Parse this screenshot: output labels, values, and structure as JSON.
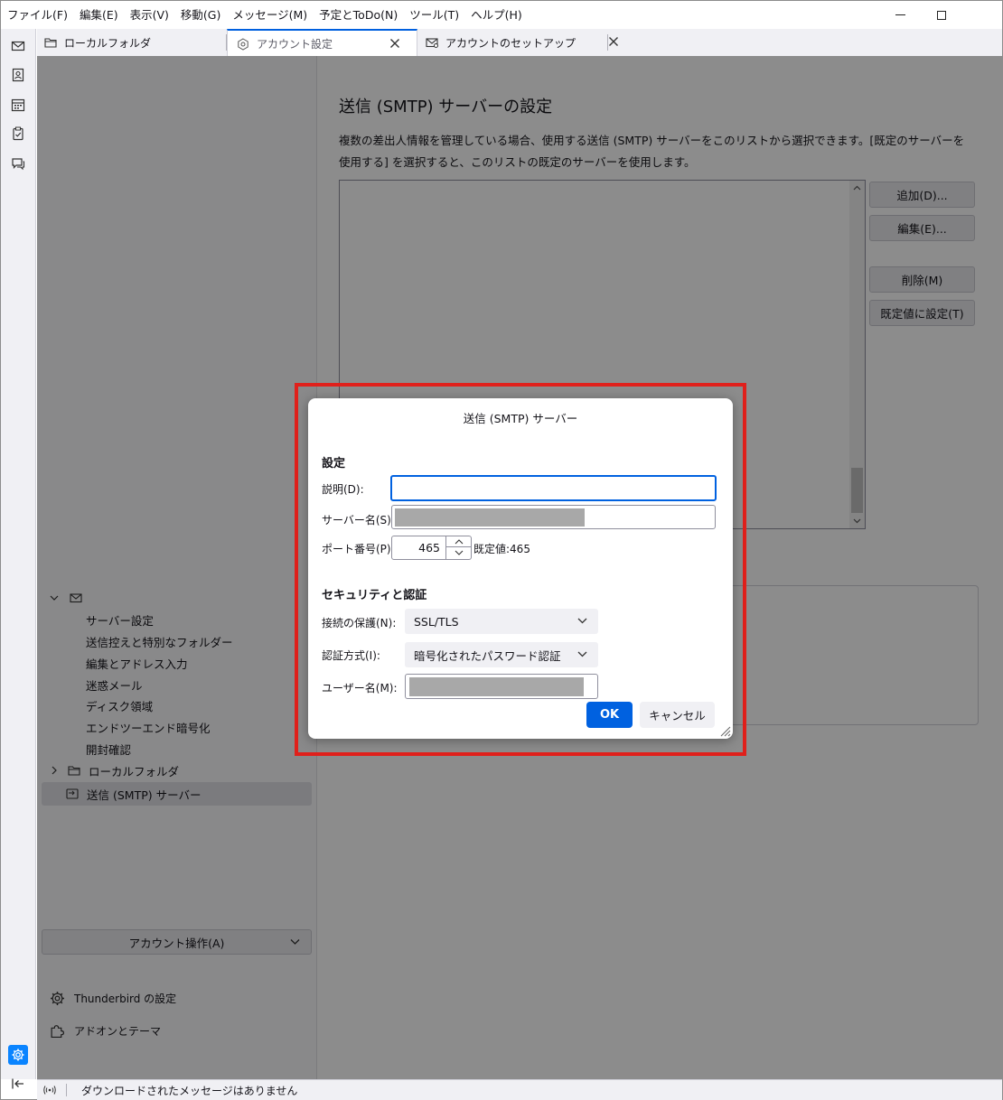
{
  "menubar": {
    "items": [
      "ファイル(F)",
      "編集(E)",
      "表示(V)",
      "移動(G)",
      "メッセージ(M)",
      "予定とToDo(N)",
      "ツール(T)",
      "ヘルプ(H)"
    ]
  },
  "tabs": [
    {
      "label": "ローカルフォルダ",
      "icon": "folder-icon"
    },
    {
      "label": "アカウント設定",
      "icon": "settings-icon"
    },
    {
      "label": "アカウントのセットアップ",
      "icon": "mail-setup-icon"
    }
  ],
  "main": {
    "heading": "送信 (SMTP) サーバーの設定",
    "description": "複数の差出人情報を管理している場合、使用する送信 (SMTP) サーバーをこのリストから選択できます。[既定のサーバーを使用する] を選択すると、このリストの既定のサーバーを使用します。",
    "buttons": {
      "add": "追加(D)...",
      "edit": "編集(E)...",
      "remove": "削除(M)",
      "set_default": "既定値に設定(T)"
    }
  },
  "sidebar": {
    "account_children": [
      "サーバー設定",
      "送信控えと特別なフォルダー",
      "編集とアドレス入力",
      "迷惑メール",
      "ディスク領域",
      "エンドツーエンド暗号化",
      "開封確認"
    ],
    "local_folders": "ローカルフォルダ",
    "smtp": "送信 (SMTP) サーバー",
    "account_actions": "アカウント操作(A)",
    "settings_link": "Thunderbird の設定",
    "addons_link": "アドオンとテーマ"
  },
  "status": {
    "text": "ダウンロードされたメッセージはありません"
  },
  "dialog": {
    "title": "送信 (SMTP) サーバー",
    "settings_heading": "設定",
    "description_label": "説明(D):",
    "description_value": "",
    "server_label": "サーバー名(S):",
    "port_label": "ポート番号(P):",
    "port_value": "465",
    "port_default": "既定値:465",
    "security_heading": "セキュリティと認証",
    "connection_label": "接続の保護(N):",
    "connection_value": "SSL/TLS",
    "auth_label": "認証方式(I):",
    "auth_value": "暗号化されたパスワード認証",
    "username_label": "ユーザー名(M):",
    "ok": "OK",
    "cancel": "キャンセル"
  },
  "colors": {
    "accent": "#0061e0",
    "highlight_frame": "#e0201b"
  }
}
